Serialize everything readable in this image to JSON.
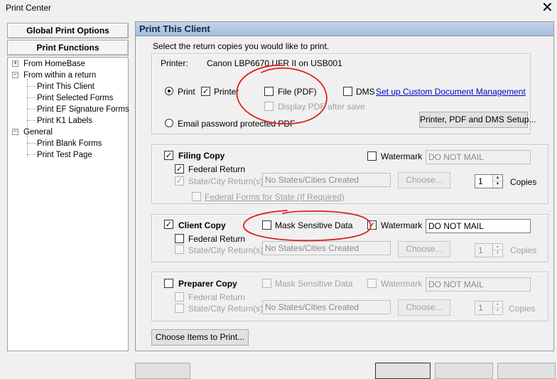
{
  "window": {
    "title": "Print Center",
    "close_glyph": "✕"
  },
  "sidebar": {
    "buttons": [
      "Global Print Options",
      "Print Functions"
    ],
    "tree": {
      "from_homebase": "From HomeBase",
      "from_within_return": "From within a return",
      "return_items": [
        "Print This Client",
        "Print Selected Forms",
        "Print EF Signature Forms",
        "Print K1 Labels"
      ],
      "general": "General",
      "general_items": [
        "Print Blank Forms",
        "Print Test Page"
      ],
      "expand_glyph": "+",
      "collapse_glyph": "−"
    }
  },
  "panel": {
    "title": "Print This Client",
    "instruction": "Select the return copies you would like to print.",
    "printer_label": "Printer:",
    "printer_name": "Canon LBP6670 UFR II on USB001",
    "print_radio": "Print",
    "printer_cb": "Printer",
    "file_pdf_cb": "File (PDF)",
    "display_pdf_cb": "Display PDF after save",
    "dms_cb": "DMS",
    "setup_link": "Set up Custom Document Management",
    "email_radio": "Email password protected PDF",
    "setup_button": "Printer, PDF and DMS Setup...",
    "check_glyph": "✓",
    "spin_up": "▲",
    "spin_down": "▼",
    "filing": {
      "title": "Filing Copy",
      "federal": "Federal Return",
      "state": "State/City Return(s)",
      "states_value": "No States/Cities Created",
      "choose": "Choose...",
      "federal_forms": "Federal Forms for State (If Required)",
      "watermark": "Watermark",
      "watermark_value": "DO NOT MAIL",
      "copies": "1",
      "copies_label": "Copies"
    },
    "client": {
      "title": "Client Copy",
      "mask": "Mask Sensitive Data",
      "federal": "Federal Return",
      "state": "State/City Return(s)",
      "states_value": "No States/Cities Created",
      "choose": "Choose...",
      "watermark": "Watermark",
      "watermark_value": "DO NOT MAIL",
      "copies": "1",
      "copies_label": "Copies"
    },
    "preparer": {
      "title": "Preparer Copy",
      "mask": "Mask Sensitive Data",
      "federal": "Federal Return",
      "state": "State/City Return(s)",
      "states_value": "No States/Cities Created",
      "choose": "Choose...",
      "watermark": "Watermark",
      "watermark_value": "DO NOT MAIL",
      "copies": "1",
      "copies_label": "Copies"
    },
    "choose_items_button": "Choose Items to Print..."
  },
  "colors": {
    "annotation": "#e0201c",
    "header_bg": "#b6c8e2",
    "link": "#0000cc"
  }
}
